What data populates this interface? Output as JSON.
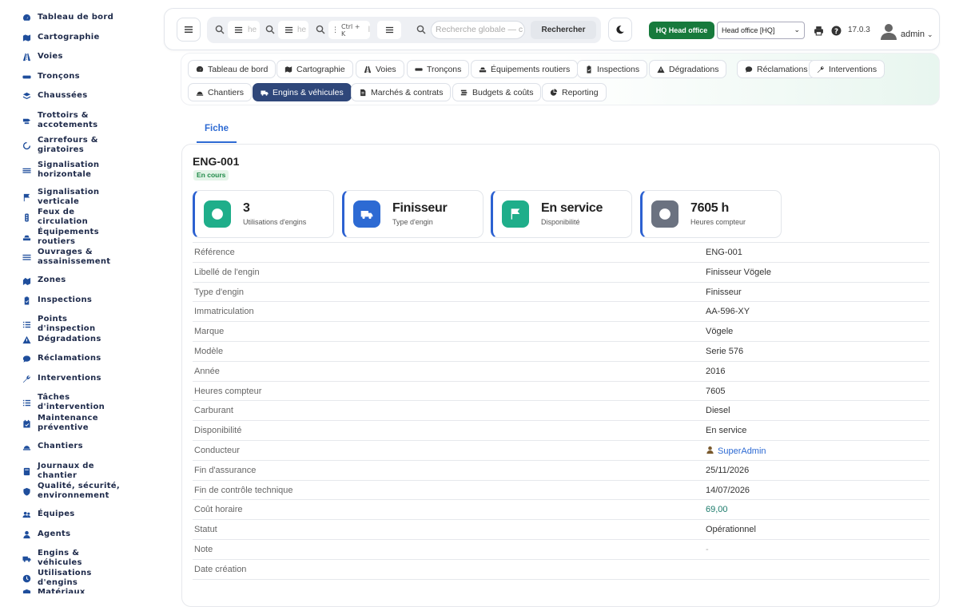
{
  "sidebar": {
    "items": [
      {
        "label": "Tableau de bord",
        "icon": "dashboard-icon"
      },
      {
        "label": "Cartographie",
        "icon": "map-icon"
      },
      {
        "label": "Voies",
        "icon": "road-icon"
      },
      {
        "label": "Tronçons",
        "icon": "segment-icon"
      },
      {
        "label": "Chaussées",
        "icon": "layers-icon"
      },
      {
        "label": "Trottoirs & accotements",
        "icon": "sidewalk-icon"
      },
      {
        "label": "Carrefours & giratoires",
        "icon": "roundabout-icon"
      },
      {
        "label": "Signalisation horizontale",
        "icon": "road-marking-icon"
      },
      {
        "label": "Signalisation verticale",
        "icon": "flag-icon"
      },
      {
        "label": "Feux de circulation",
        "icon": "traffic-light-icon"
      },
      {
        "label": "Équipements routiers",
        "icon": "equipment-icon"
      },
      {
        "label": "Ouvrages & assainissement",
        "icon": "water-icon"
      },
      {
        "label": "Zones",
        "icon": "zones-icon"
      },
      {
        "label": "Inspections",
        "icon": "clipboard-icon"
      },
      {
        "label": "Points d'inspection",
        "icon": "list-icon"
      },
      {
        "label": "Dégradations",
        "icon": "warning-icon"
      },
      {
        "label": "Réclamations",
        "icon": "comment-icon"
      },
      {
        "label": "Interventions",
        "icon": "wrench-icon"
      },
      {
        "label": "Tâches d'intervention",
        "icon": "tasks-icon"
      },
      {
        "label": "Maintenance préventive",
        "icon": "calendar-icon"
      },
      {
        "label": "Chantiers",
        "icon": "hardhat-icon"
      },
      {
        "label": "Journaux de chantier",
        "icon": "book-icon"
      },
      {
        "label": "Qualité, sécurité, environnement",
        "icon": "shield-icon"
      },
      {
        "label": "Équipes",
        "icon": "users-icon"
      },
      {
        "label": "Agents",
        "icon": "user-icon"
      },
      {
        "label": "Engins & véhicules",
        "icon": "truck-icon"
      },
      {
        "label": "Utilisations d'engins",
        "icon": "clock-icon"
      },
      {
        "label": "Matériaux",
        "icon": "box-icon"
      }
    ]
  },
  "topbar": {
    "search_placeholder_1": "he",
    "search_placeholder_2": "he",
    "shortcut": "Ctrl + K",
    "search_placeholder_3": "l",
    "global_search_placeholder": "Recherche globale — c",
    "search_button": "Rechercher",
    "hq_badge": "HQ Head office",
    "office_select": "Head office [HQ]",
    "version": "17.0.3",
    "user": "admin"
  },
  "nav_tiles": [
    {
      "label": "Tableau de bord",
      "icon": "dashboard-icon",
      "active": false
    },
    {
      "label": "Cartographie",
      "icon": "map-icon",
      "active": false
    },
    {
      "label": "Voies",
      "icon": "road-icon",
      "active": false
    },
    {
      "label": "Tronçons",
      "icon": "segment-icon",
      "active": false
    },
    {
      "label": "Équipements routiers",
      "icon": "equipment-icon",
      "active": false
    },
    {
      "label": "Inspections",
      "icon": "clipboard-icon",
      "active": false
    },
    {
      "label": "Dégradations",
      "icon": "warning-icon",
      "active": false
    },
    {
      "label": "Réclamations",
      "icon": "comment-icon",
      "active": false
    },
    {
      "label": "Interventions",
      "icon": "wrench-icon",
      "active": false
    },
    {
      "label": "Chantiers",
      "icon": "hardhat-icon",
      "active": false
    },
    {
      "label": "Engins & véhicules",
      "icon": "truck-icon",
      "active": true
    },
    {
      "label": "Marchés & contrats",
      "icon": "contract-icon",
      "active": false
    },
    {
      "label": "Budgets & coûts",
      "icon": "money-icon",
      "active": false
    },
    {
      "label": "Reporting",
      "icon": "chart-pie-icon",
      "active": false
    }
  ],
  "tabs": {
    "fiche": "Fiche"
  },
  "record": {
    "title": "ENG-001",
    "status": "En cours",
    "stats": [
      {
        "value": "3",
        "label": "Utilisations d'engins",
        "icon": "clock-icon",
        "color": "#1fae8a"
      },
      {
        "value": "Finisseur",
        "label": "Type d'engin",
        "icon": "truck-icon",
        "color": "#2d6ad3"
      },
      {
        "value": "En service",
        "label": "Disponibilité",
        "icon": "flag-icon",
        "color": "#1fae8a"
      },
      {
        "value": "7605 h",
        "label": "Heures compteur",
        "icon": "clock-icon",
        "color": "#6b7280"
      }
    ],
    "fields": [
      {
        "key": "Référence",
        "value": "ENG-001"
      },
      {
        "key": "Libellé de l'engin",
        "value": "Finisseur Vögele"
      },
      {
        "key": "Type d'engin",
        "value": "Finisseur"
      },
      {
        "key": "Immatriculation",
        "value": "AA-596-XY"
      },
      {
        "key": "Marque",
        "value": "Vögele"
      },
      {
        "key": "Modèle",
        "value": "Serie 576"
      },
      {
        "key": "Année",
        "value": "2016"
      },
      {
        "key": "Heures compteur",
        "value": "7605"
      },
      {
        "key": "Carburant",
        "value": "Diesel"
      },
      {
        "key": "Disponibilité",
        "value": "En service"
      },
      {
        "key": "Conducteur",
        "value": "SuperAdmin",
        "style": "link"
      },
      {
        "key": "Fin d'assurance",
        "value": "25/11/2026"
      },
      {
        "key": "Fin de contrôle technique",
        "value": "14/07/2026"
      },
      {
        "key": "Coût horaire",
        "value": "69,00",
        "style": "num"
      },
      {
        "key": "Statut",
        "value": "Opérationnel"
      },
      {
        "key": "Note",
        "value": "-",
        "style": "dash"
      },
      {
        "key": "Date création",
        "value": ""
      }
    ]
  }
}
